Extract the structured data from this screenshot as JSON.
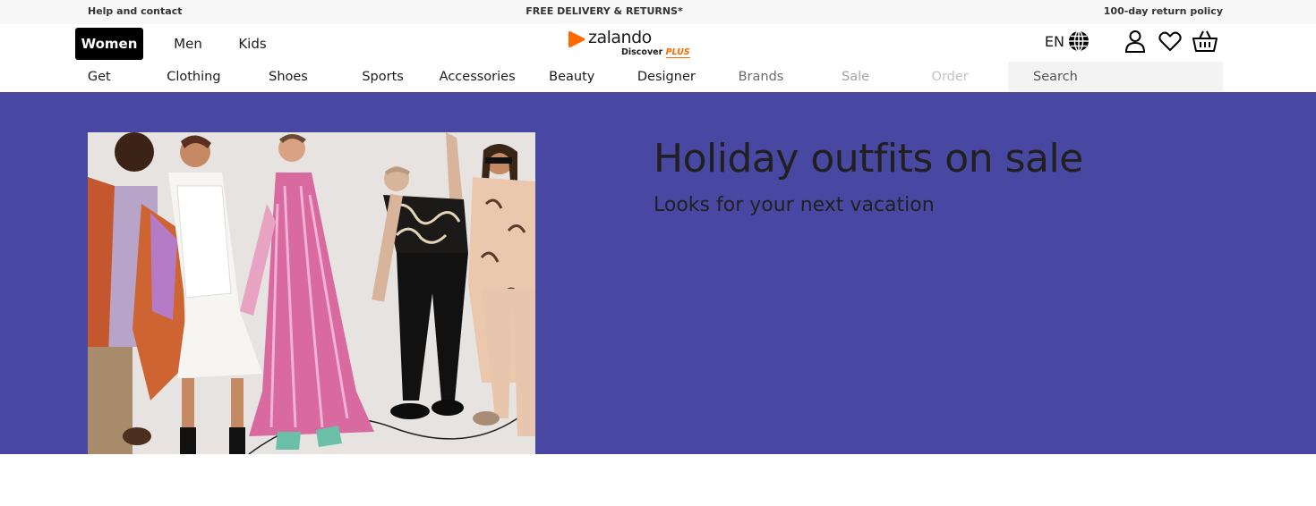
{
  "utility_bar": {
    "help": "Help and contact",
    "promo": "FREE DELIVERY & RETURNS*",
    "returns": "100-day return policy"
  },
  "gender_tabs": [
    {
      "label": "Women",
      "active": true
    },
    {
      "label": "Men",
      "active": false
    },
    {
      "label": "Kids",
      "active": false
    }
  ],
  "logo": {
    "word": "zalando",
    "sub": "Discover",
    "plus": "PLUS",
    "brand_color": "#ff6900"
  },
  "header_icons": {
    "language": "EN",
    "language_icon": "globe-icon",
    "account_icon": "user-icon",
    "wishlist_icon": "heart-icon",
    "cart_icon": "basket-icon"
  },
  "categories": [
    "Get",
    "Clothing",
    "Shoes",
    "Sports",
    "Accessories",
    "Beauty",
    "Designer",
    "Brands",
    "Sale",
    "Order"
  ],
  "search": {
    "placeholder": "Search"
  },
  "hero": {
    "title": "Holiday outfits on sale",
    "subtitle": "Looks for your next vacation",
    "background": "#4848a3"
  }
}
